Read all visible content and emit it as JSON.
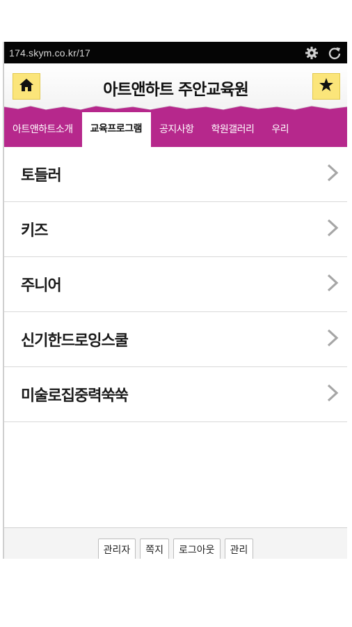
{
  "statusbar": {
    "url": "174.skym.co.kr/17",
    "icons": [
      "gear-icon",
      "refresh-icon"
    ]
  },
  "header": {
    "title": "아트앤하트 주안교육원",
    "left_icon": "home-icon",
    "right_icon": "star-icon"
  },
  "tabs": [
    {
      "label": "아트앤하트소개",
      "active": false
    },
    {
      "label": "교육프로그램",
      "active": true
    },
    {
      "label": "공지사항",
      "active": false
    },
    {
      "label": "학원갤러리",
      "active": false
    },
    {
      "label": "우리",
      "active": false
    }
  ],
  "list": {
    "items": [
      {
        "label": "토들러"
      },
      {
        "label": "키즈"
      },
      {
        "label": "주니어"
      },
      {
        "label": "신기한드로잉스쿨"
      },
      {
        "label": "미술로집중력쑥쑥"
      }
    ]
  },
  "footer": {
    "buttons": [
      "관리자",
      "쪽지",
      "로그아웃",
      "관리"
    ]
  },
  "colors": {
    "tab_bar": "#b6288c",
    "header_button": "#fbe57a",
    "statusbar": "#050505"
  }
}
